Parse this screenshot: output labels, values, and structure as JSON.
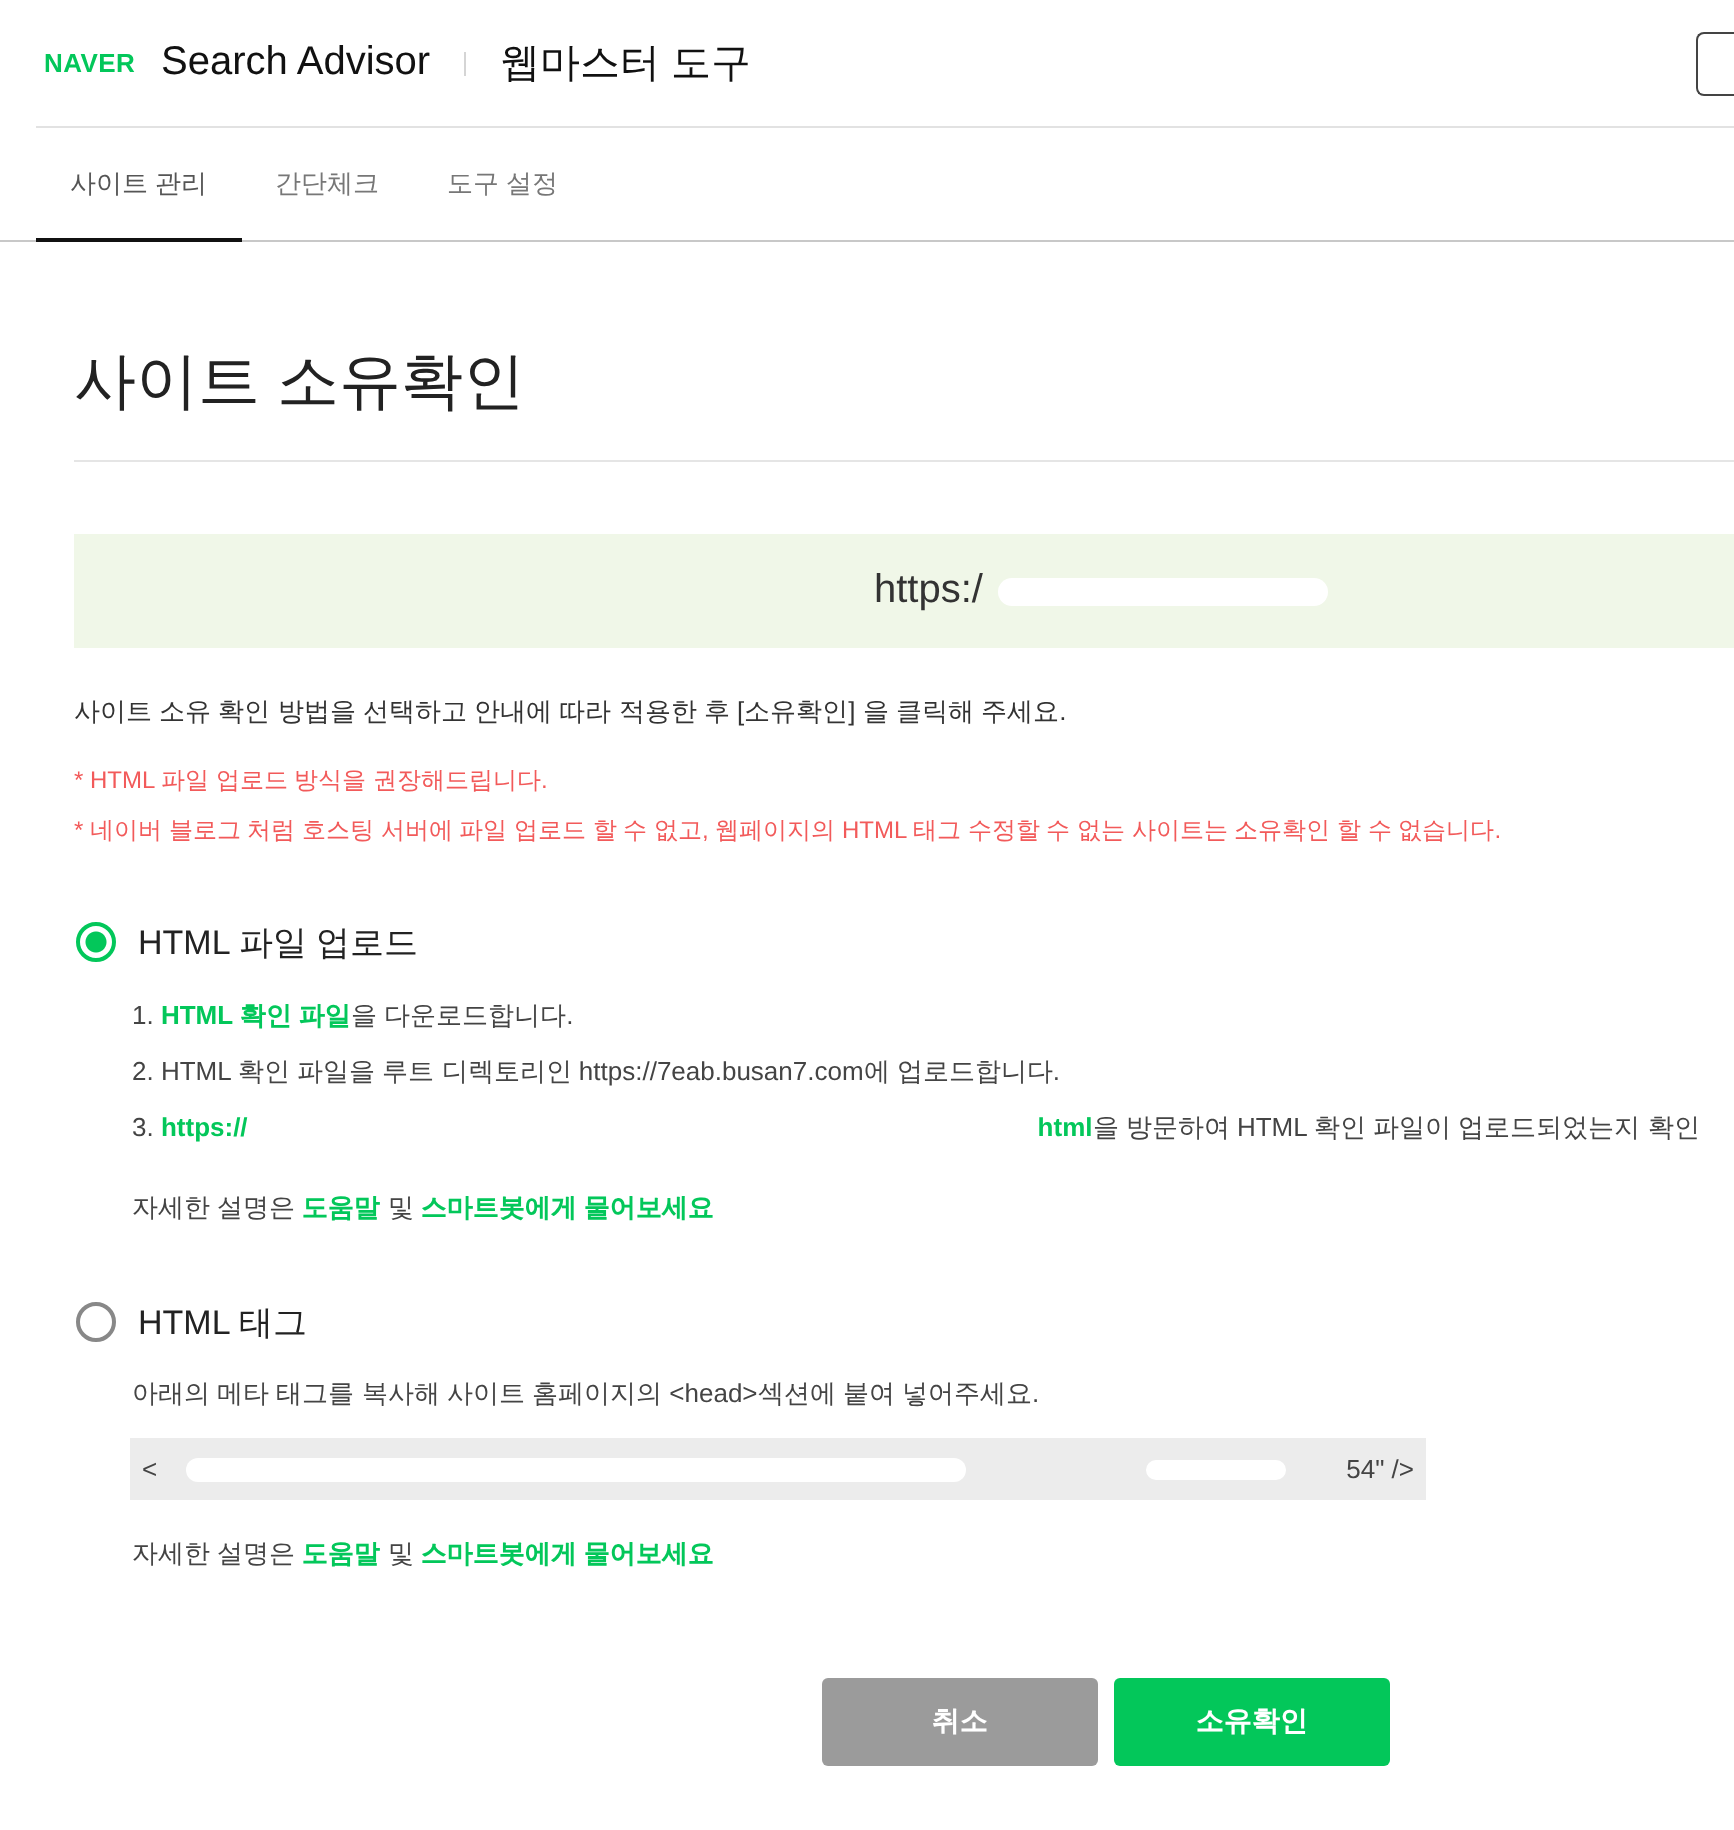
{
  "header": {
    "logo": "NAVER",
    "product": "Search Advisor",
    "section": "웹마스터 도구"
  },
  "tabs": [
    {
      "label": "사이트 관리",
      "selected": true
    },
    {
      "label": "간단체크",
      "selected": false
    },
    {
      "label": "도구 설정",
      "selected": false
    }
  ],
  "page_title": "사이트 소유확인",
  "site_url": "https:/",
  "instruction": "사이트 소유 확인 방법을 선택하고 안내에 따라 적용한 후 [소유확인] 을 클릭해 주세요.",
  "notes": [
    "* HTML 파일 업로드 방식을 권장해드립니다.",
    "* 네이버 블로그 처럼 호스팅 서버에 파일 업로드 할 수 없고, 웹페이지의 HTML 태그 수정할 수 없는 사이트는 소유확인 할 수 없습니다."
  ],
  "methods": [
    {
      "kind": "file",
      "label": "HTML 파일 업로드",
      "selected": true,
      "steps": [
        [
          {
            "kind": "text",
            "text": "1. "
          },
          {
            "kind": "link",
            "text": "HTML 확인 파일"
          },
          {
            "kind": "text",
            "text": "을 다운로드합니다."
          }
        ],
        [
          {
            "kind": "text",
            "text": "2. HTML 확인 파일을 루트 디렉토리인 https://7eab.busan7.com에 업로드합니다."
          }
        ],
        [
          {
            "kind": "text",
            "text": "3. "
          },
          {
            "kind": "link",
            "text": "https://"
          },
          {
            "kind": "link",
            "text": "html",
            "redacted_before": true
          },
          {
            "kind": "text",
            "text": "을 방문하여 HTML 확인 파일이 업로드되었는지 확인"
          }
        ]
      ],
      "help": [
        {
          "kind": "text",
          "text": "자세한 설명은 "
        },
        {
          "kind": "link",
          "text": "도움말"
        },
        {
          "kind": "text",
          "text": " 및 "
        },
        {
          "kind": "link",
          "text": "스마트봇에게 물어보세요"
        }
      ]
    },
    {
      "kind": "tag",
      "label": "HTML 태그",
      "selected": false,
      "description": "아래의 메타 태그를 복사해 사이트 홈페이지의 <head>섹션에 붙여 넣어주세요.",
      "meta_tag": {
        "start": "<",
        "end": "54\" />"
      },
      "help": [
        {
          "kind": "text",
          "text": "자세한 설명은 "
        },
        {
          "kind": "link",
          "text": "도움말"
        },
        {
          "kind": "text",
          "text": " 및 "
        },
        {
          "kind": "link",
          "text": "스마트봇에게 물어보세요"
        }
      ]
    }
  ],
  "buttons": [
    {
      "kind": "cancel",
      "label": "취소"
    },
    {
      "kind": "confirm",
      "label": "소유확인"
    }
  ]
}
